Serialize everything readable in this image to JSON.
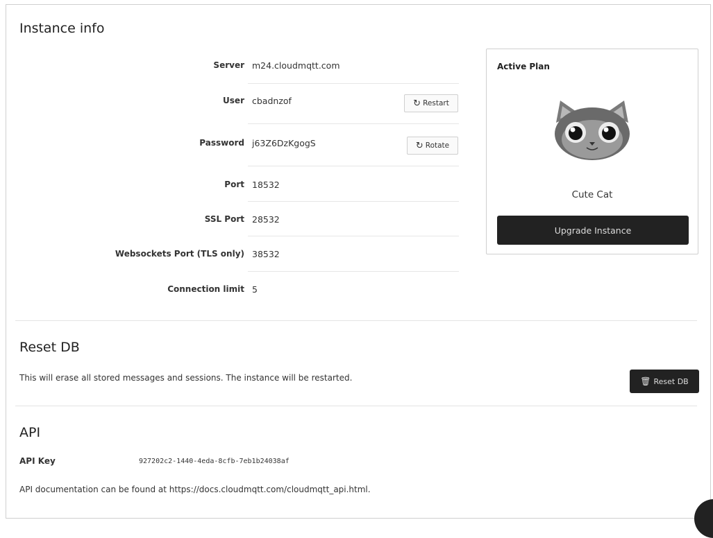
{
  "instance_info": {
    "title": "Instance info",
    "fields": [
      {
        "label": "Server",
        "value": "m24.cloudmqtt.com"
      },
      {
        "label": "User",
        "value": "cbadnzof"
      },
      {
        "label": "Password",
        "value": "j63Z6DzKgogS"
      },
      {
        "label": "Port",
        "value": "18532"
      },
      {
        "label": "SSL Port",
        "value": "28532"
      },
      {
        "label": "Websockets Port (TLS only)",
        "value": "38532"
      },
      {
        "label": "Connection limit",
        "value": "5"
      }
    ],
    "restart_label": "Restart",
    "rotate_label": "Rotate"
  },
  "plan": {
    "title": "Active Plan",
    "name": "Cute Cat",
    "upgrade_label": "Upgrade Instance"
  },
  "reset_db": {
    "title": "Reset DB",
    "description": "This will erase all stored messages and sessions. The instance will be restarted.",
    "button_label": "Reset DB"
  },
  "api": {
    "title": "API",
    "key_label": "API Key",
    "key_value": "927202c2-1440-4eda-8cfb-7eb1b24038af",
    "docs_text": "API documentation can be found at https://docs.cloudmqtt.com/cloudmqtt_api.html."
  },
  "icons": {
    "refresh": "refresh-icon",
    "trash": "trash-icon",
    "cat": "cat-mascot-icon"
  },
  "colors": {
    "dark_button": "#222222",
    "border": "#cfcfcf"
  }
}
